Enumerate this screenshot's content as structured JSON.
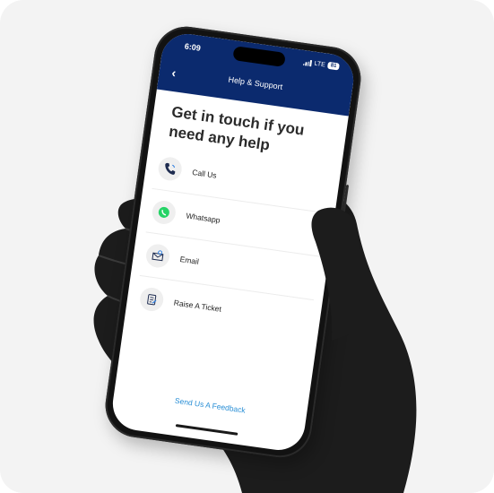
{
  "status_bar": {
    "time": "6:09",
    "network": "LTE",
    "battery": "81"
  },
  "header": {
    "title": "Help & Support"
  },
  "main": {
    "heading": "Get in touch if you need any help",
    "options": [
      {
        "label": "Call Us",
        "icon": "phone-icon"
      },
      {
        "label": "Whatsapp",
        "icon": "whatsapp-icon"
      },
      {
        "label": "Email",
        "icon": "email-icon"
      },
      {
        "label": "Raise A Ticket",
        "icon": "ticket-icon"
      }
    ],
    "feedback_link": "Send Us A Feedback"
  },
  "colors": {
    "header_bg": "#0b2a6e",
    "link": "#2a8fd6",
    "whatsapp": "#25d366",
    "accent_blue": "#2b7de0"
  }
}
